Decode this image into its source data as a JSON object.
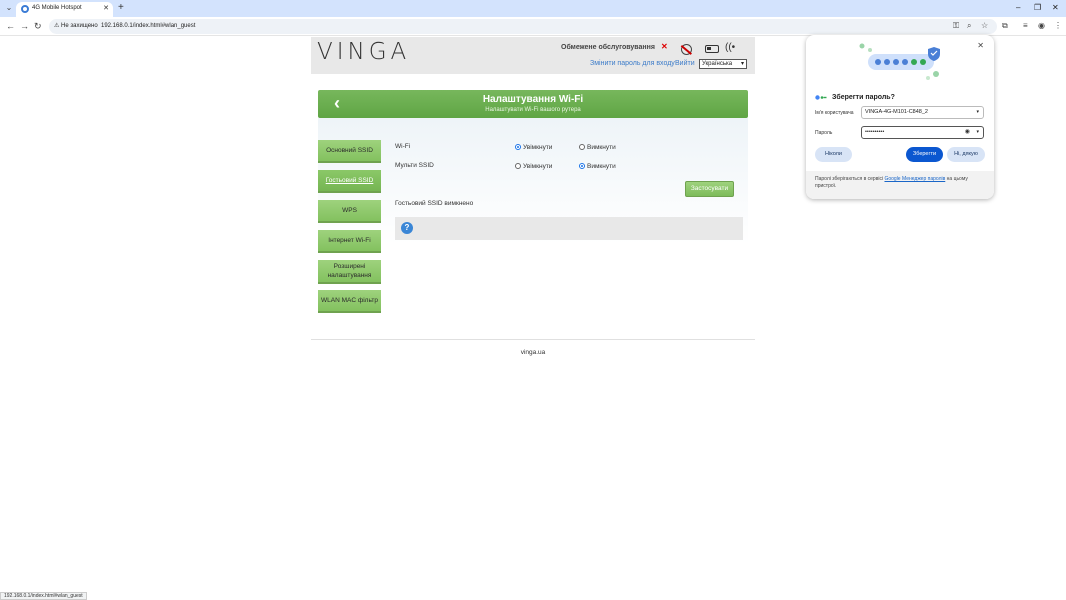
{
  "browser": {
    "tab_title": "4G Mobile Hotspot",
    "new_tab_icon": "+",
    "security_label": "Не захищено",
    "url": "192.168.0.1/index.html#wlan_guest",
    "status_url": "192.168.0.1/index.html#wlan_guest"
  },
  "header": {
    "logo": "VINGA",
    "service_label": "Обмежене обслуговування",
    "change_password": "Змінити пароль для входу",
    "logout": "Вийти",
    "language": "Українська"
  },
  "banner": {
    "title": "Налаштування Wi-Fi",
    "subtitle": "Налаштувати Wi-Fi вашого рутера"
  },
  "sidebar": {
    "items": [
      {
        "label": "Основний SSID"
      },
      {
        "label": "Гостьовий SSID"
      },
      {
        "label": "WPS"
      },
      {
        "label": "Інтернет Wi-Fi"
      },
      {
        "label": "Розширені налаштування"
      },
      {
        "label": "WLAN MAC фільтр"
      }
    ]
  },
  "form": {
    "wifi_label": "Wi-Fi",
    "multi_ssid_label": "Мульти SSID",
    "on_label": "Увімкнути",
    "off_label": "Вимкнути",
    "wifi_selected": "on",
    "multi_ssid_selected": "off",
    "apply_label": "Застосувати",
    "status_text": "Гостьовий SSID вимкнено",
    "help_symbol": "?"
  },
  "footer": {
    "site": "vinga.ua"
  },
  "password_popup": {
    "title": "Зберегти пароль?",
    "username_label": "Ім'я користувача",
    "username_value": "VINGA-4G-M101-C848_2",
    "password_label": "Пароль",
    "password_value": "••••••••••",
    "never_label": "Ніколи",
    "save_label": "Зберегти",
    "no_thanks_label": "Ні, дякую",
    "footer_prefix": "Паролі зберігаються в сервісі ",
    "footer_link": "Google Менеджер паролів",
    "footer_suffix": " на цьому пристрої."
  },
  "colors": {
    "accent_green": "#5fa544",
    "button_green": "#9ed27d",
    "link_blue": "#3d7cc9",
    "chrome_primary": "#0b57d0"
  }
}
